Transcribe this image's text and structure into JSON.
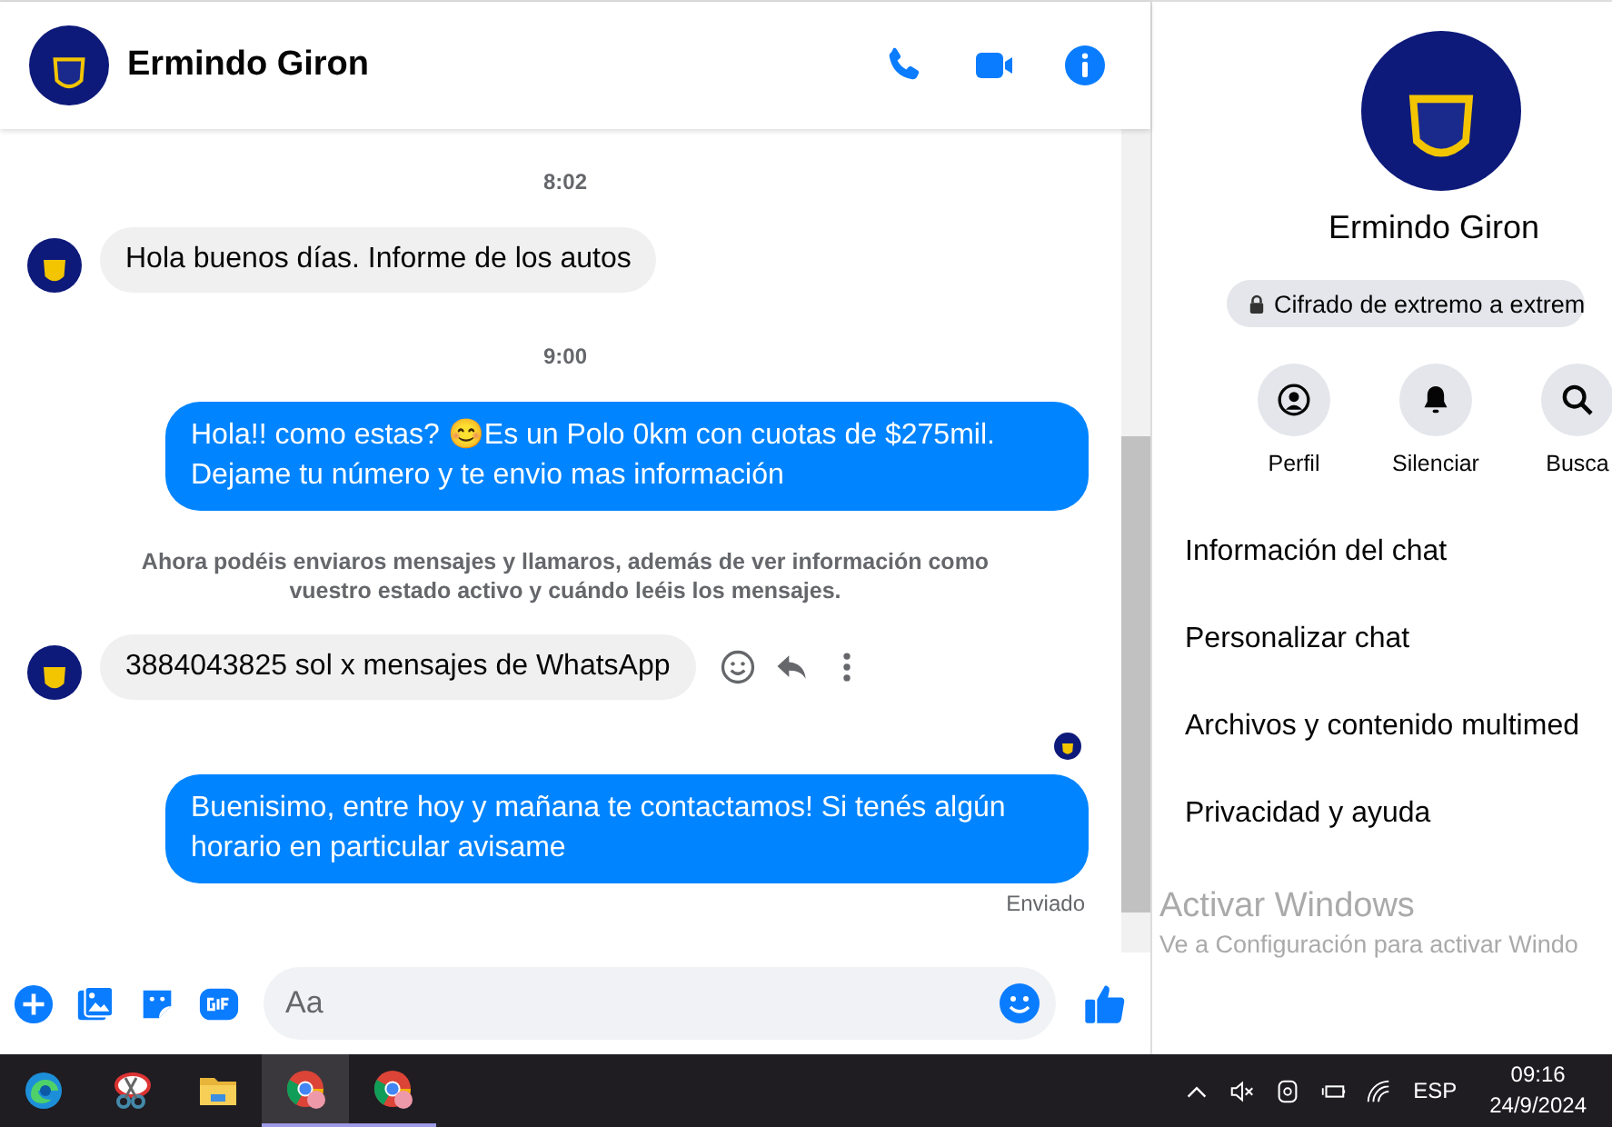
{
  "chat_header": {
    "name": "Ermindo Giron"
  },
  "messages": [
    {
      "kind": "time",
      "text": "8:02"
    },
    {
      "kind": "incoming",
      "text": "Hola buenos días. Informe de los autos",
      "actions": false
    },
    {
      "kind": "time",
      "text": "9:00"
    },
    {
      "kind": "outgoing",
      "text": "Hola!! como estas? 😊Es un Polo 0km con cuotas de $275mil. Dejame tu número y te envio mas información"
    },
    {
      "kind": "notice",
      "text": "Ahora podéis enviaros mensajes y llamaros, además de ver información como vuestro estado activo y cuándo leéis los mensajes."
    },
    {
      "kind": "incoming",
      "text": "3884043825 sol x mensajes de WhatsApp",
      "actions": true
    },
    {
      "kind": "seen"
    },
    {
      "kind": "outgoing",
      "text": "Buenisimo, entre hoy y mañana te contactamos! Si tenés algún horario en particular avisame"
    },
    {
      "kind": "status",
      "text": "Enviado"
    }
  ],
  "composer": {
    "placeholder": "Aa"
  },
  "details": {
    "name": "Ermindo Giron",
    "encryption": "Cifrado de extremo a extrem",
    "actions": [
      {
        "kind": "profile",
        "label": "Perfil"
      },
      {
        "kind": "mute",
        "label": "Silenciar"
      },
      {
        "kind": "search",
        "label": "Busca"
      }
    ],
    "menu": [
      "Información del chat",
      "Personalizar chat",
      "Archivos y contenido multimed",
      "Privacidad y ayuda"
    ]
  },
  "activation_notice": {
    "title": "Activar Windows",
    "text": "Ve a Configuración para activar Windo"
  },
  "taskbar": {
    "apps": [
      {
        "kind": "edge",
        "active": false,
        "running": false
      },
      {
        "kind": "snip",
        "active": false,
        "running": false
      },
      {
        "kind": "folder",
        "active": false,
        "running": false
      },
      {
        "kind": "chrome",
        "active": true,
        "running": true
      },
      {
        "kind": "chrome",
        "active": false,
        "running": true
      }
    ],
    "language": "ESP",
    "time": "09:16",
    "date": "24/9/2024"
  }
}
